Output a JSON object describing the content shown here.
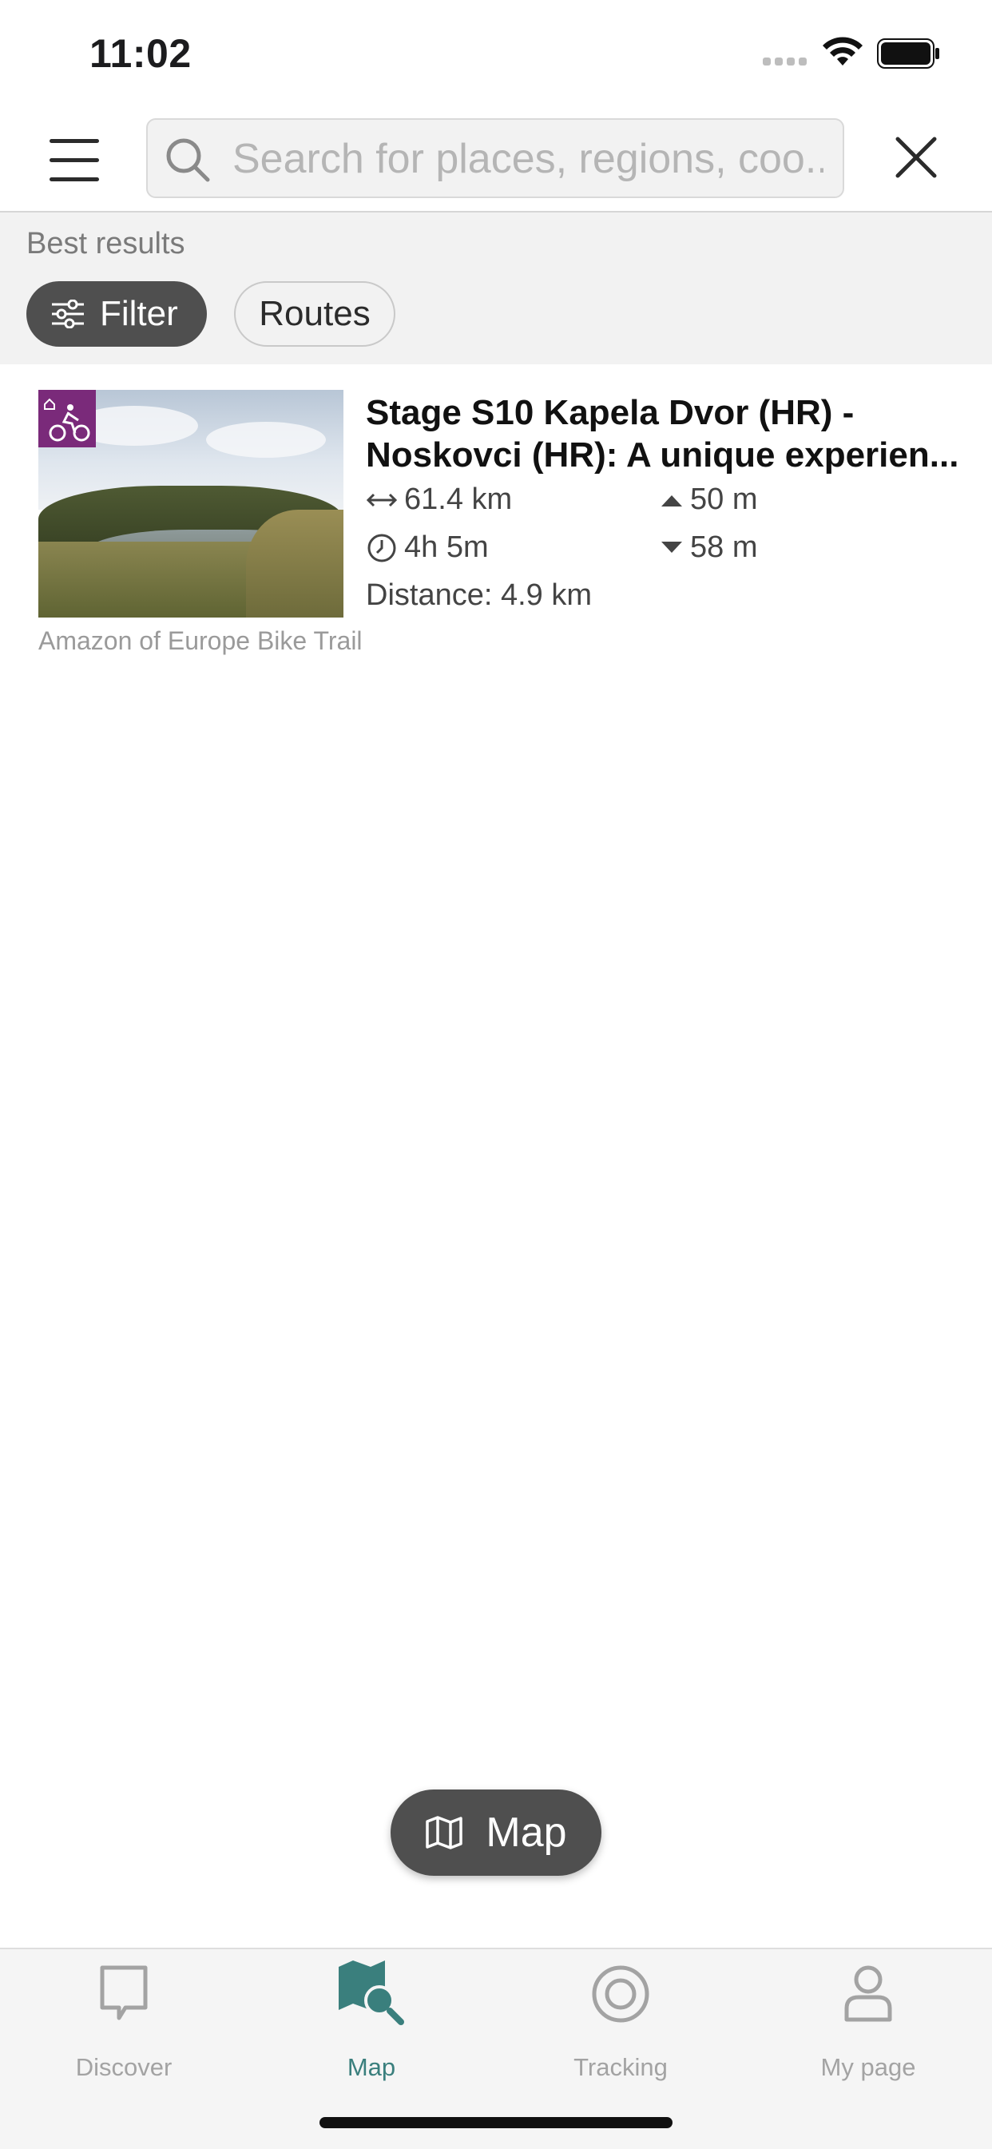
{
  "status_bar": {
    "time": "11:02"
  },
  "search": {
    "placeholder": "Search for places, regions, coo..."
  },
  "results_header": {
    "label": "Best results",
    "filter_label": "Filter",
    "routes_label": "Routes"
  },
  "result": {
    "title_line1": "Stage S10 Kapela Dvor (HR) -",
    "title_line2": "Noskovci (HR): A unique experien...",
    "length": "61.4 km",
    "duration": "4h 5m",
    "ascent": "50 m",
    "descent": "58 m",
    "distance": "Distance: 4.9 km",
    "source": "Amazon of Europe Bike Trail",
    "category_icon": "cycling-icon"
  },
  "map_button": {
    "label": "Map"
  },
  "tabs": [
    {
      "label": "Discover",
      "icon": "discover-icon"
    },
    {
      "label": "Map",
      "icon": "map-search-icon"
    },
    {
      "label": "Tracking",
      "icon": "tracking-icon"
    },
    {
      "label": "My page",
      "icon": "user-icon"
    }
  ],
  "colors": {
    "accent": "#3a7f7d",
    "badge": "#7a2a7a",
    "chip_dark": "#4f4f4f"
  }
}
